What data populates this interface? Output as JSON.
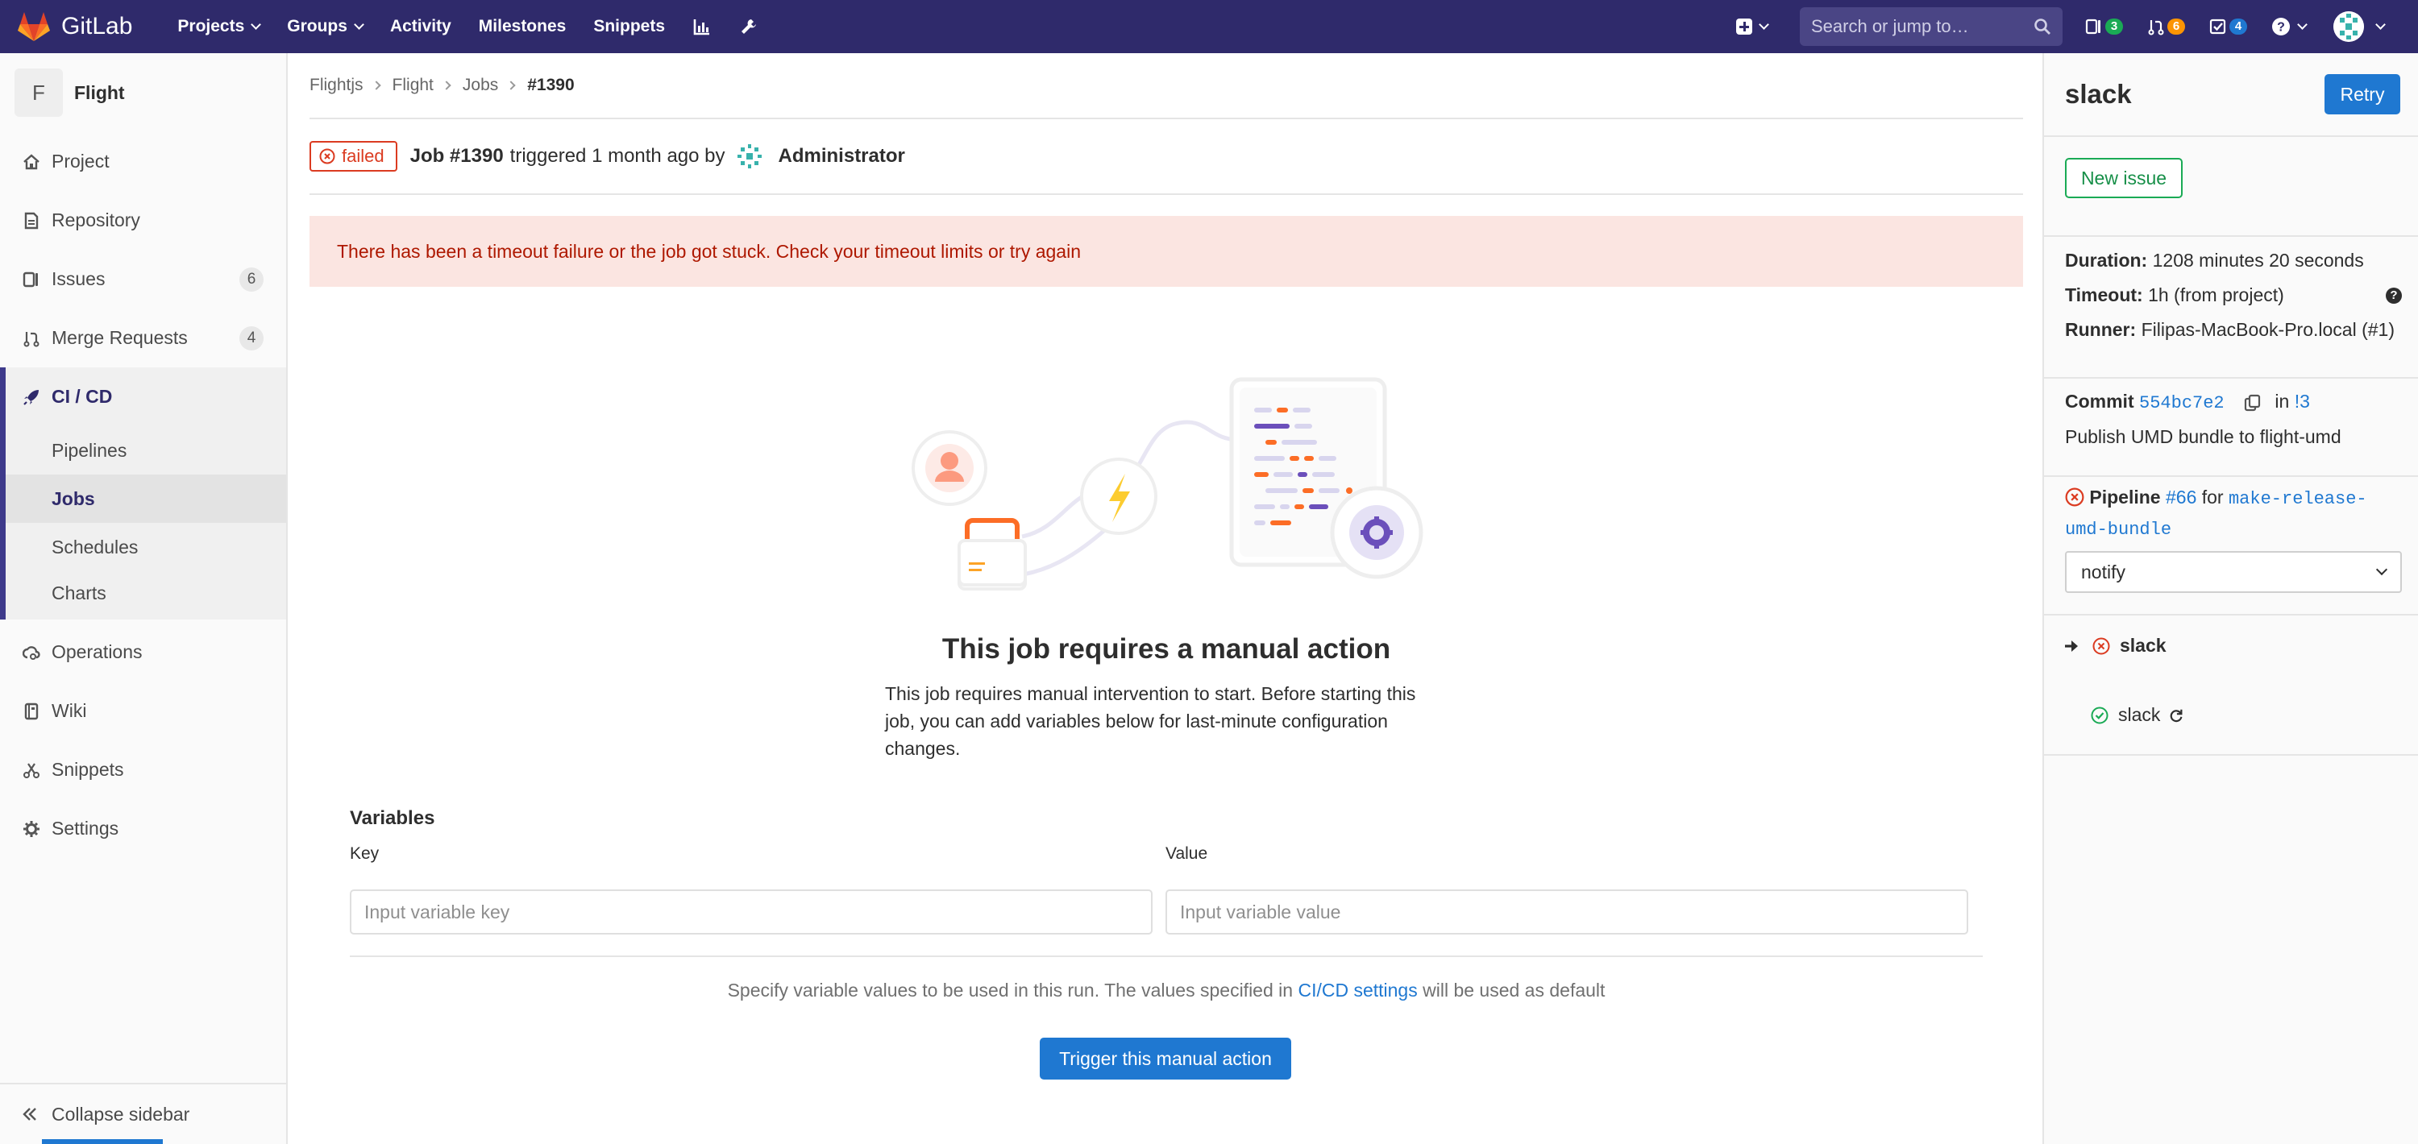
{
  "navbar": {
    "brand": "GitLab",
    "links": [
      "Projects",
      "Groups",
      "Activity",
      "Milestones",
      "Snippets"
    ],
    "search_placeholder": "Search or jump to…",
    "counters": {
      "issues": "3",
      "merge_requests": "6",
      "todos": "4"
    },
    "colors": {
      "bg": "#2f2a6b",
      "issues_badge": "#1aaa55",
      "mr_badge": "#fc9403",
      "todos_badge": "#1f78d1"
    }
  },
  "sidebar": {
    "project_initial": "F",
    "project_name": "Flight",
    "items": [
      {
        "label": "Project",
        "icon": "home-icon"
      },
      {
        "label": "Repository",
        "icon": "doc-icon"
      },
      {
        "label": "Issues",
        "icon": "issues-icon",
        "count": "6"
      },
      {
        "label": "Merge Requests",
        "icon": "merge-request-icon",
        "count": "4"
      }
    ],
    "ci": {
      "label": "CI / CD",
      "sub": [
        "Pipelines",
        "Jobs",
        "Schedules",
        "Charts"
      ],
      "active": "Jobs"
    },
    "items_after": [
      {
        "label": "Operations",
        "icon": "cloud-gear-icon"
      },
      {
        "label": "Wiki",
        "icon": "book-icon"
      },
      {
        "label": "Snippets",
        "icon": "scissors-icon"
      },
      {
        "label": "Settings",
        "icon": "gear-icon"
      }
    ],
    "collapse_label": "Collapse sidebar"
  },
  "breadcrumb": [
    "Flightjs",
    "Flight",
    "Jobs",
    "#1390"
  ],
  "job": {
    "status": "failed",
    "title": "Job #1390",
    "triggered_text": "triggered 1 month ago by",
    "user": "Administrator"
  },
  "alert": "There has been a timeout failure or the job got stuck. Check your timeout limits or try again",
  "empty_state": {
    "title": "This job requires a manual action",
    "text": "This job requires manual intervention to start. Before starting this job, you can add variables below for last-minute configuration changes."
  },
  "variables": {
    "title": "Variables",
    "key_label": "Key",
    "value_label": "Value",
    "key_placeholder": "Input variable key",
    "value_placeholder": "Input variable value",
    "help_before": "Specify variable values to be used in this run. The values specified in ",
    "help_link": "CI/CD settings",
    "help_after": " will be used as default",
    "trigger_label": "Trigger this manual action"
  },
  "right_sidebar": {
    "title": "slack",
    "retry_label": "Retry",
    "new_issue_label": "New issue",
    "duration_label": "Duration:",
    "duration_value": "1208 minutes 20 seconds",
    "timeout_label": "Timeout:",
    "timeout_value": "1h (from project)",
    "runner_label": "Runner:",
    "runner_value": "Filipas-MacBook-Pro.local (#1)",
    "commit_label": "Commit",
    "commit_sha": "554bc7e2",
    "commit_in": "in",
    "commit_mr": "!3",
    "commit_message": "Publish UMD bundle to flight-umd",
    "pipeline_label": "Pipeline",
    "pipeline_id": "#66",
    "pipeline_for": "for",
    "pipeline_ref_line1": "make-release-",
    "pipeline_ref_line2": "umd-bundle",
    "stage": "notify",
    "jobs": [
      {
        "name": "slack",
        "status": "failed",
        "current": true
      },
      {
        "name": "slack",
        "status": "success",
        "current": false
      }
    ]
  }
}
